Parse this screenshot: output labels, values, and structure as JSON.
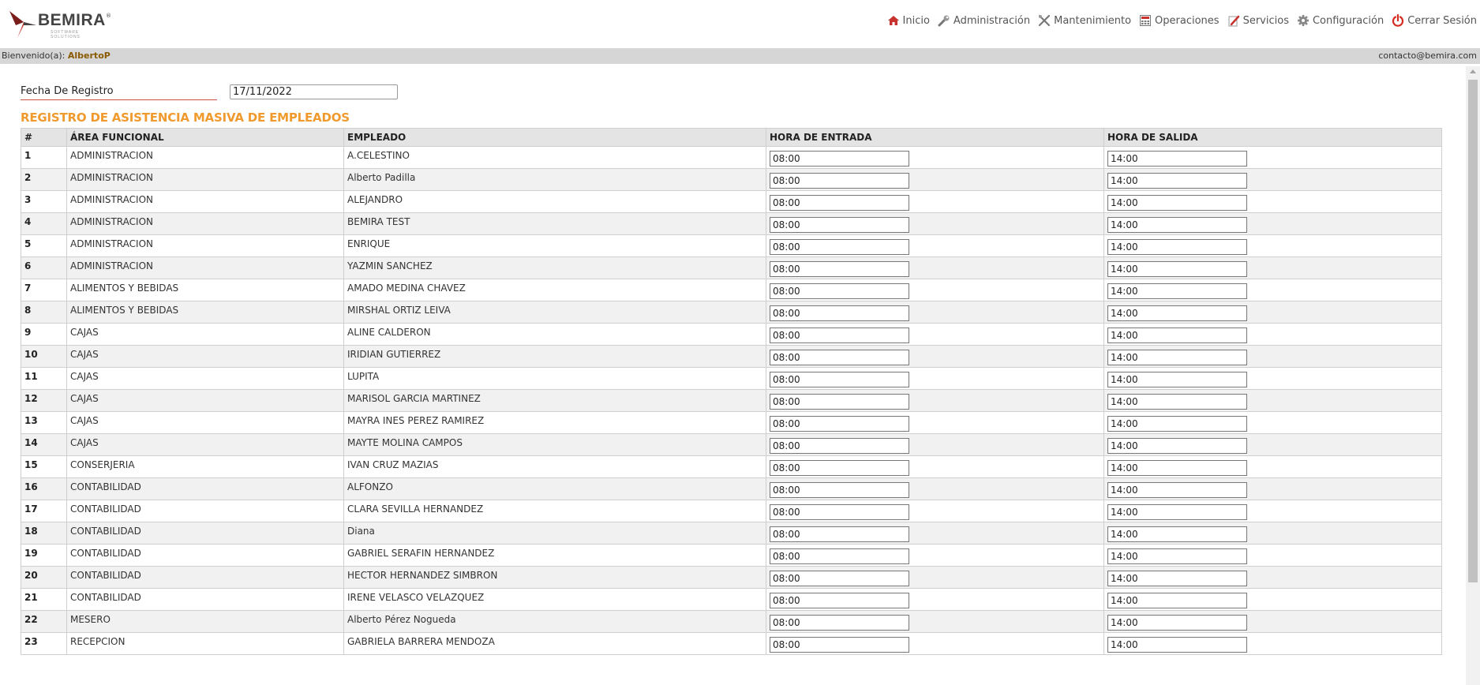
{
  "brand": {
    "name": "BEMIRA",
    "tagline": "SOFTWARE SOLUTIONS",
    "reg": "®"
  },
  "nav": [
    {
      "label": "Inicio",
      "icon": "home-icon"
    },
    {
      "label": "Administración",
      "icon": "wrench-icon"
    },
    {
      "label": "Mantenimiento",
      "icon": "tools-icon"
    },
    {
      "label": "Operaciones",
      "icon": "calculator-icon"
    },
    {
      "label": "Servicios",
      "icon": "pen-icon"
    },
    {
      "label": "Configuración",
      "icon": "gear-icon"
    },
    {
      "label": "Cerrar Sesión",
      "icon": "power-icon"
    }
  ],
  "welcome": {
    "prefix": "Bienvenido(a): ",
    "user": "AlbertoP",
    "contact": "contacto@bemira.com"
  },
  "form": {
    "date_label": "Fecha De Registro",
    "date_value": "17/11/2022"
  },
  "section_title": "REGISTRO DE ASISTENCIA MASIVA DE EMPLEADOS",
  "table": {
    "headers": [
      "#",
      "ÁREA FUNCIONAL",
      "EMPLEADO",
      "HORA DE ENTRADA",
      "HORA DE SALIDA"
    ],
    "rows": [
      {
        "n": "1",
        "area": "ADMINISTRACION",
        "emp": "A.CELESTINO",
        "in": "08:00",
        "out": "14:00"
      },
      {
        "n": "2",
        "area": "ADMINISTRACION",
        "emp": "Alberto Padilla",
        "in": "08:00",
        "out": "14:00"
      },
      {
        "n": "3",
        "area": "ADMINISTRACION",
        "emp": "ALEJANDRO",
        "in": "08:00",
        "out": "14:00"
      },
      {
        "n": "4",
        "area": "ADMINISTRACION",
        "emp": "BEMIRA TEST",
        "in": "08:00",
        "out": "14:00"
      },
      {
        "n": "5",
        "area": "ADMINISTRACION",
        "emp": "ENRIQUE",
        "in": "08:00",
        "out": "14:00"
      },
      {
        "n": "6",
        "area": "ADMINISTRACION",
        "emp": "YAZMIN SANCHEZ",
        "in": "08:00",
        "out": "14:00"
      },
      {
        "n": "7",
        "area": "ALIMENTOS Y BEBIDAS",
        "emp": "AMADO MEDINA CHAVEZ",
        "in": "08:00",
        "out": "14:00"
      },
      {
        "n": "8",
        "area": "ALIMENTOS Y BEBIDAS",
        "emp": "MIRSHAL ORTIZ LEIVA",
        "in": "08:00",
        "out": "14:00"
      },
      {
        "n": "9",
        "area": "CAJAS",
        "emp": "ALINE CALDERON",
        "in": "08:00",
        "out": "14:00"
      },
      {
        "n": "10",
        "area": "CAJAS",
        "emp": "IRIDIAN GUTIERREZ",
        "in": "08:00",
        "out": "14:00"
      },
      {
        "n": "11",
        "area": "CAJAS",
        "emp": "LUPITA",
        "in": "08:00",
        "out": "14:00"
      },
      {
        "n": "12",
        "area": "CAJAS",
        "emp": "MARISOL GARCIA MARTINEZ",
        "in": "08:00",
        "out": "14:00"
      },
      {
        "n": "13",
        "area": "CAJAS",
        "emp": "MAYRA INES PEREZ RAMIREZ",
        "in": "08:00",
        "out": "14:00"
      },
      {
        "n": "14",
        "area": "CAJAS",
        "emp": "MAYTE MOLINA CAMPOS",
        "in": "08:00",
        "out": "14:00"
      },
      {
        "n": "15",
        "area": "CONSERJERIA",
        "emp": "IVAN CRUZ MAZIAS",
        "in": "08:00",
        "out": "14:00"
      },
      {
        "n": "16",
        "area": "CONTABILIDAD",
        "emp": "ALFONZO",
        "in": "08:00",
        "out": "14:00"
      },
      {
        "n": "17",
        "area": "CONTABILIDAD",
        "emp": "CLARA SEVILLA HERNANDEZ",
        "in": "08:00",
        "out": "14:00"
      },
      {
        "n": "18",
        "area": "CONTABILIDAD",
        "emp": "Diana",
        "in": "08:00",
        "out": "14:00"
      },
      {
        "n": "19",
        "area": "CONTABILIDAD",
        "emp": "GABRIEL SERAFIN HERNANDEZ",
        "in": "08:00",
        "out": "14:00"
      },
      {
        "n": "20",
        "area": "CONTABILIDAD",
        "emp": "HECTOR HERNANDEZ SIMBRON",
        "in": "08:00",
        "out": "14:00"
      },
      {
        "n": "21",
        "area": "CONTABILIDAD",
        "emp": "IRENE VELASCO VELAZQUEZ",
        "in": "08:00",
        "out": "14:00"
      },
      {
        "n": "22",
        "area": "MESERO",
        "emp": "Alberto Pérez Nogueda",
        "in": "08:00",
        "out": "14:00"
      },
      {
        "n": "23",
        "area": "RECEPCION",
        "emp": "GABRIELA BARRERA MENDOZA",
        "in": "08:00",
        "out": "14:00"
      }
    ]
  },
  "colors": {
    "accent": "#f09a2e",
    "user": "#8a5a00",
    "welcome_bg": "#d6d6d6",
    "logo_red": "#c8322e"
  }
}
